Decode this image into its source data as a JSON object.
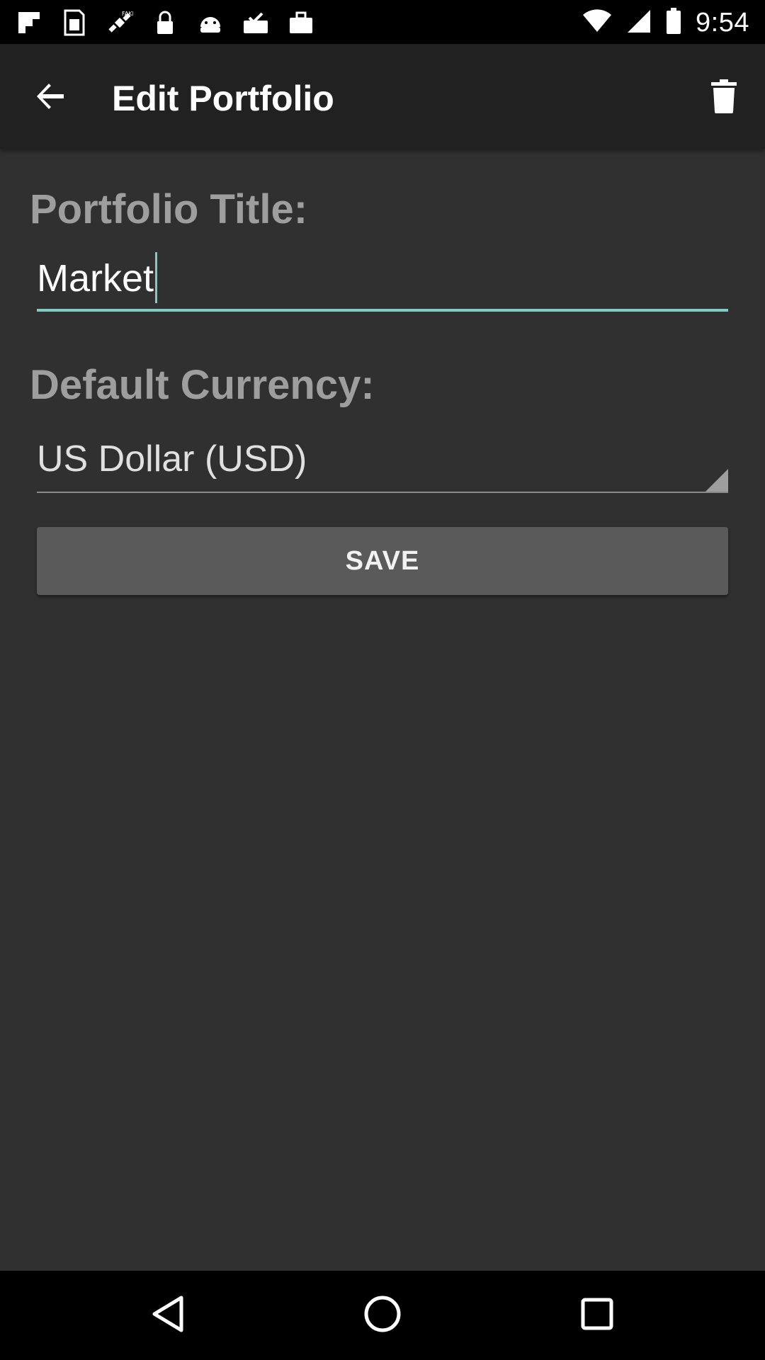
{
  "status_bar": {
    "time": "9:54",
    "icons": [
      "flipboard-icon",
      "sim-card-icon",
      "satellite-fake-gps-icon",
      "lock-icon",
      "android-debug-icon",
      "inbox-check-icon",
      "briefcase-icon",
      "wifi-icon",
      "signal-icon",
      "battery-icon"
    ]
  },
  "app_bar": {
    "title": "Edit Portfolio",
    "back_icon": "arrow-back-icon",
    "delete_icon": "trash-icon"
  },
  "form": {
    "portfolio_title_label": "Portfolio Title:",
    "portfolio_title_value": "Market",
    "default_currency_label": "Default Currency:",
    "default_currency_value": "US Dollar (USD)",
    "save_label": "SAVE"
  },
  "colors": {
    "background": "#303030",
    "app_bar": "#212121",
    "accent": "#80cbc4",
    "label_gray": "#9e9e9e",
    "button": "#5a5a5a"
  },
  "nav_bar": {
    "icons": [
      "back-triangle-icon",
      "home-circle-icon",
      "recents-square-icon"
    ]
  }
}
